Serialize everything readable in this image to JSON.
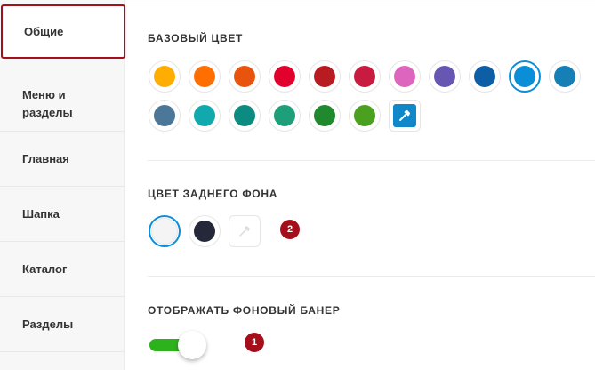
{
  "sidebar": {
    "items": [
      {
        "label": "Общие",
        "active": true
      },
      {
        "label": "Меню и разделы",
        "active": false
      },
      {
        "label": "Главная",
        "active": false
      },
      {
        "label": "Шапка",
        "active": false
      },
      {
        "label": "Каталог",
        "active": false
      },
      {
        "label": "Разделы",
        "active": false
      }
    ]
  },
  "sections": {
    "base_color": {
      "title": "БАЗОВЫЙ ЦВЕТ",
      "swatches": [
        "#ffad00",
        "#ff6e00",
        "#e8540e",
        "#e2002d",
        "#b81c22",
        "#c71b40",
        "#de65bd",
        "#6757b2",
        "#0d5ea5",
        "#0b8ed8",
        "#1680b6",
        "#4b7898",
        "#10a9ae",
        "#0e8b80",
        "#1f9e7a",
        "#20892e",
        "#4aa120"
      ],
      "selected_index": 9,
      "picker_icon": "eyedropper-icon",
      "picker_color": "#0f87c9"
    },
    "background_color": {
      "title": "ЦВЕТ ЗАДНЕГО ФОНА",
      "swatches": [
        "#f4f4f4",
        "#242838"
      ],
      "selected_index": 0,
      "picker_icon": "eyedropper-icon",
      "badge": "2"
    },
    "banner": {
      "title": "ОТОБРАЖАТЬ ФОНОВЫЙ БАНЕР",
      "enabled": true,
      "badge": "1"
    }
  },
  "colors": {
    "accent": "#a50f1c",
    "toggle_on": "#2db21d",
    "selected_ring": "#0b8ed8"
  }
}
